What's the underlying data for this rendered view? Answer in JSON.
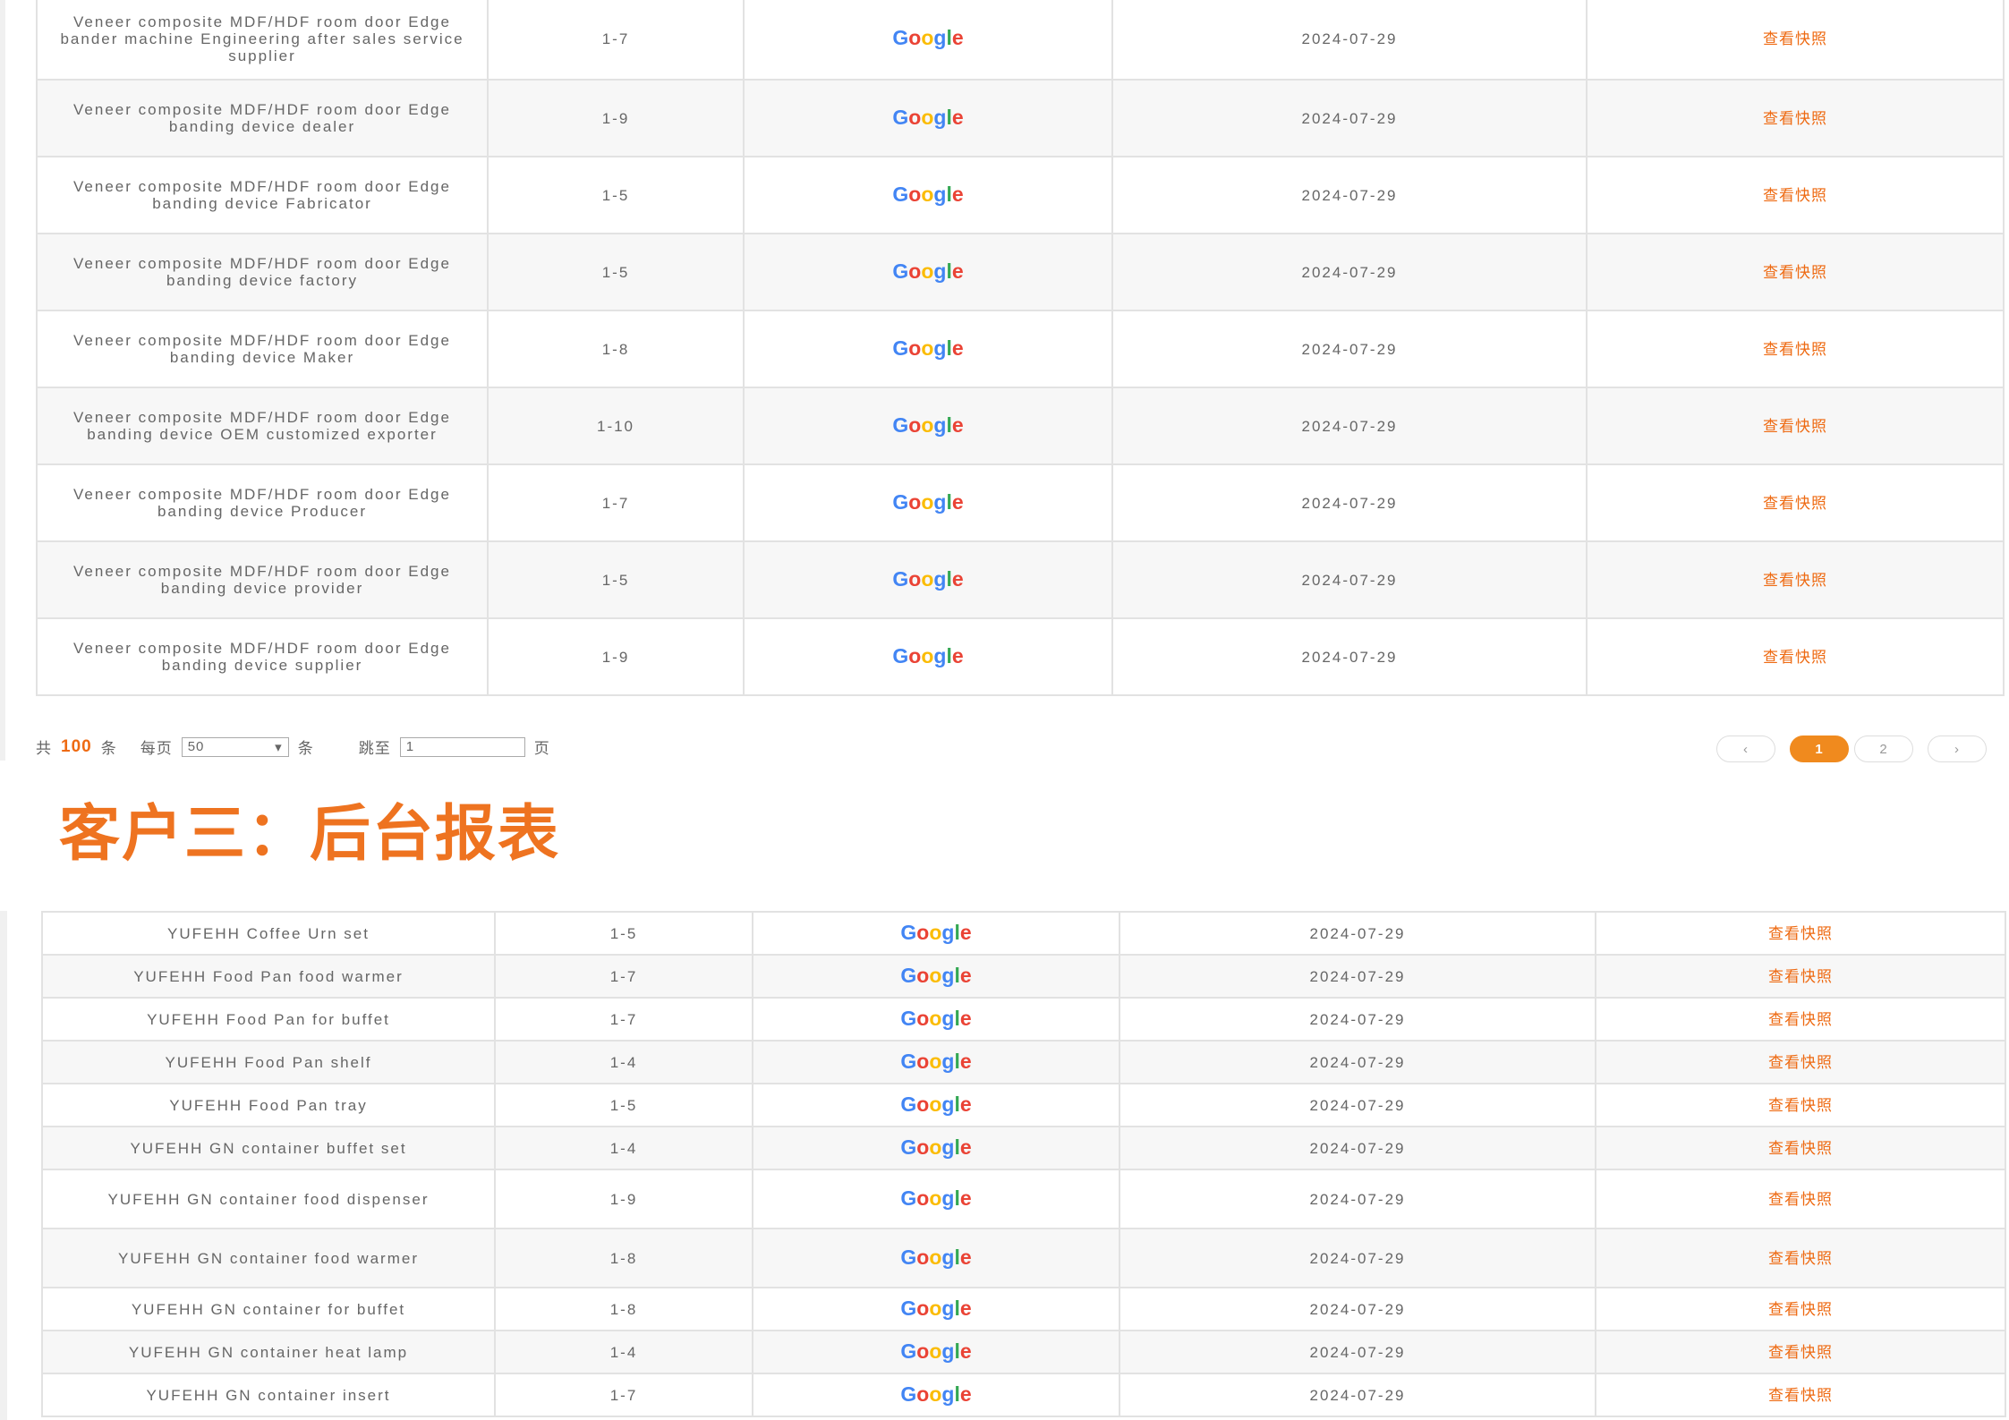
{
  "table1": {
    "rows": [
      {
        "keyword": "Veneer composite MDF/HDF room door Edge bander machine Engineering after sales service supplier",
        "rank": "1-7",
        "engine": "Google",
        "date": "2024-07-29",
        "snapshot": "查看快照"
      },
      {
        "keyword": "Veneer composite MDF/HDF room door Edge banding device dealer",
        "rank": "1-9",
        "engine": "Google",
        "date": "2024-07-29",
        "snapshot": "查看快照"
      },
      {
        "keyword": "Veneer composite MDF/HDF room door Edge banding device Fabricator",
        "rank": "1-5",
        "engine": "Google",
        "date": "2024-07-29",
        "snapshot": "查看快照"
      },
      {
        "keyword": "Veneer composite MDF/HDF room door Edge banding device factory",
        "rank": "1-5",
        "engine": "Google",
        "date": "2024-07-29",
        "snapshot": "查看快照"
      },
      {
        "keyword": "Veneer composite MDF/HDF room door Edge banding device Maker",
        "rank": "1-8",
        "engine": "Google",
        "date": "2024-07-29",
        "snapshot": "查看快照"
      },
      {
        "keyword": "Veneer composite MDF/HDF room door Edge banding device OEM customized exporter",
        "rank": "1-10",
        "engine": "Google",
        "date": "2024-07-29",
        "snapshot": "查看快照"
      },
      {
        "keyword": "Veneer composite MDF/HDF room door Edge banding device Producer",
        "rank": "1-7",
        "engine": "Google",
        "date": "2024-07-29",
        "snapshot": "查看快照"
      },
      {
        "keyword": "Veneer composite MDF/HDF room door Edge banding device provider",
        "rank": "1-5",
        "engine": "Google",
        "date": "2024-07-29",
        "snapshot": "查看快照"
      },
      {
        "keyword": "Veneer composite MDF/HDF room door Edge banding device supplier",
        "rank": "1-9",
        "engine": "Google",
        "date": "2024-07-29",
        "snapshot": "查看快照"
      }
    ]
  },
  "pager": {
    "total_prefix": "共",
    "total": "100",
    "total_suffix": "条",
    "per_page_label": "每页",
    "per_page_value": "50",
    "per_page_suffix": "条",
    "goto_label": "跳至",
    "goto_value": "1",
    "goto_suffix": "页",
    "prev": "‹",
    "current": "1",
    "next_page": "2",
    "next": "›"
  },
  "section": {
    "title": "客户三：后台报表"
  },
  "table2": {
    "rows": [
      {
        "keyword": "YUFEHH Coffee Urn set",
        "rank": "1-5",
        "engine": "Google",
        "date": "2024-07-29",
        "snapshot": "查看快照"
      },
      {
        "keyword": "YUFEHH Food Pan food warmer",
        "rank": "1-7",
        "engine": "Google",
        "date": "2024-07-29",
        "snapshot": "查看快照"
      },
      {
        "keyword": "YUFEHH Food Pan for buffet",
        "rank": "1-7",
        "engine": "Google",
        "date": "2024-07-29",
        "snapshot": "查看快照"
      },
      {
        "keyword": "YUFEHH Food Pan shelf",
        "rank": "1-4",
        "engine": "Google",
        "date": "2024-07-29",
        "snapshot": "查看快照"
      },
      {
        "keyword": "YUFEHH Food Pan tray",
        "rank": "1-5",
        "engine": "Google",
        "date": "2024-07-29",
        "snapshot": "查看快照"
      },
      {
        "keyword": "YUFEHH GN container buffet set",
        "rank": "1-4",
        "engine": "Google",
        "date": "2024-07-29",
        "snapshot": "查看快照"
      },
      {
        "keyword": "YUFEHH GN container food dispenser",
        "rank": "1-9",
        "engine": "Google",
        "date": "2024-07-29",
        "snapshot": "查看快照"
      },
      {
        "keyword": "YUFEHH GN container food warmer",
        "rank": "1-8",
        "engine": "Google",
        "date": "2024-07-29",
        "snapshot": "查看快照"
      },
      {
        "keyword": "YUFEHH GN container for buffet",
        "rank": "1-8",
        "engine": "Google",
        "date": "2024-07-29",
        "snapshot": "查看快照"
      },
      {
        "keyword": "YUFEHH GN container heat lamp",
        "rank": "1-4",
        "engine": "Google",
        "date": "2024-07-29",
        "snapshot": "查看快照"
      },
      {
        "keyword": "YUFEHH GN container insert",
        "rank": "1-7",
        "engine": "Google",
        "date": "2024-07-29",
        "snapshot": "查看快照"
      }
    ]
  },
  "colors": {
    "accent_orange": "#ee6a12",
    "title_orange": "#ee7320",
    "google_blue": "#4285F4",
    "google_red": "#EA4335",
    "google_yellow": "#FBBC05",
    "google_green": "#34A853"
  }
}
